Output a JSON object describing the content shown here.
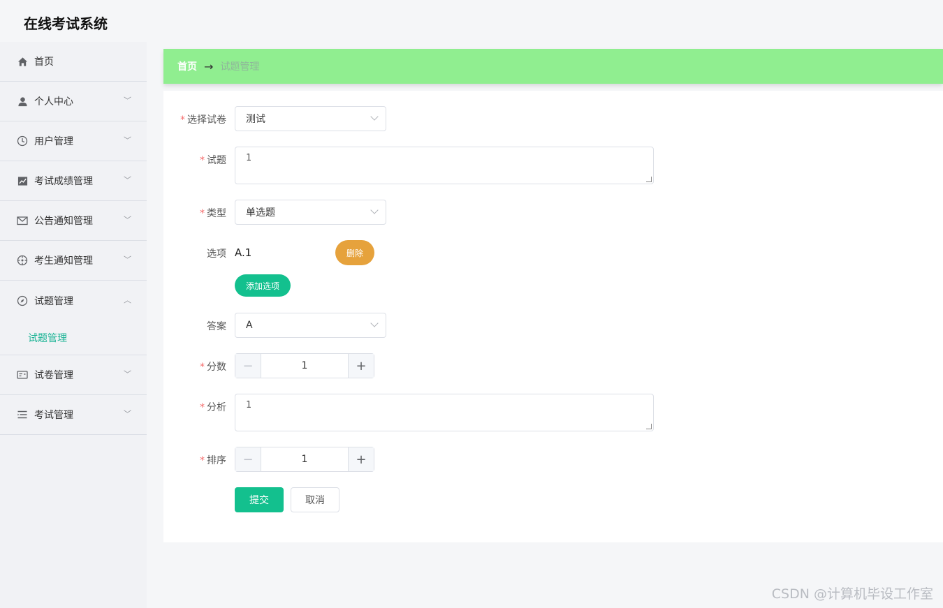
{
  "app": {
    "title": "在线考试系统"
  },
  "sidebar": {
    "items": [
      {
        "label": "首页",
        "icon": "home-icon",
        "expandable": false
      },
      {
        "label": "个人中心",
        "icon": "user-icon",
        "expandable": true
      },
      {
        "label": "用户管理",
        "icon": "clock-icon",
        "expandable": true
      },
      {
        "label": "考试成绩管理",
        "icon": "chart-icon",
        "expandable": true
      },
      {
        "label": "公告通知管理",
        "icon": "mail-icon",
        "expandable": true
      },
      {
        "label": "考生通知管理",
        "icon": "target-icon",
        "expandable": true
      },
      {
        "label": "试题管理",
        "icon": "compass-icon",
        "expandable": true,
        "expanded": true
      },
      {
        "label": "试卷管理",
        "icon": "card-icon",
        "expandable": true
      },
      {
        "label": "考试管理",
        "icon": "list-icon",
        "expandable": true
      }
    ],
    "submenu": {
      "label": "试题管理"
    },
    "accent_color": "#1ab394"
  },
  "breadcrumb": {
    "home": "首页",
    "separator": "→",
    "current": "试题管理",
    "bar_color": "#90ee90"
  },
  "form": {
    "paper": {
      "label": "选择试卷",
      "value": "测试",
      "required": true
    },
    "question": {
      "label": "试题",
      "value": "1",
      "required": true
    },
    "type": {
      "label": "类型",
      "value": "单选题",
      "required": true
    },
    "options": {
      "label": "选项",
      "items": [
        "A.1"
      ],
      "delete_label": "删除",
      "add_label": "添加选项"
    },
    "answer": {
      "label": "答案",
      "value": "A"
    },
    "score": {
      "label": "分数",
      "value": "1",
      "required": true
    },
    "analysis": {
      "label": "分析",
      "value": "1",
      "required": true
    },
    "order": {
      "label": "排序",
      "value": "1",
      "required": true
    },
    "submit_label": "提交",
    "cancel_label": "取消"
  },
  "colors": {
    "primary": "#13c08e",
    "warning": "#e6a23c",
    "required": "#f56c6c"
  },
  "watermark": "CSDN @计算机毕设工作室"
}
